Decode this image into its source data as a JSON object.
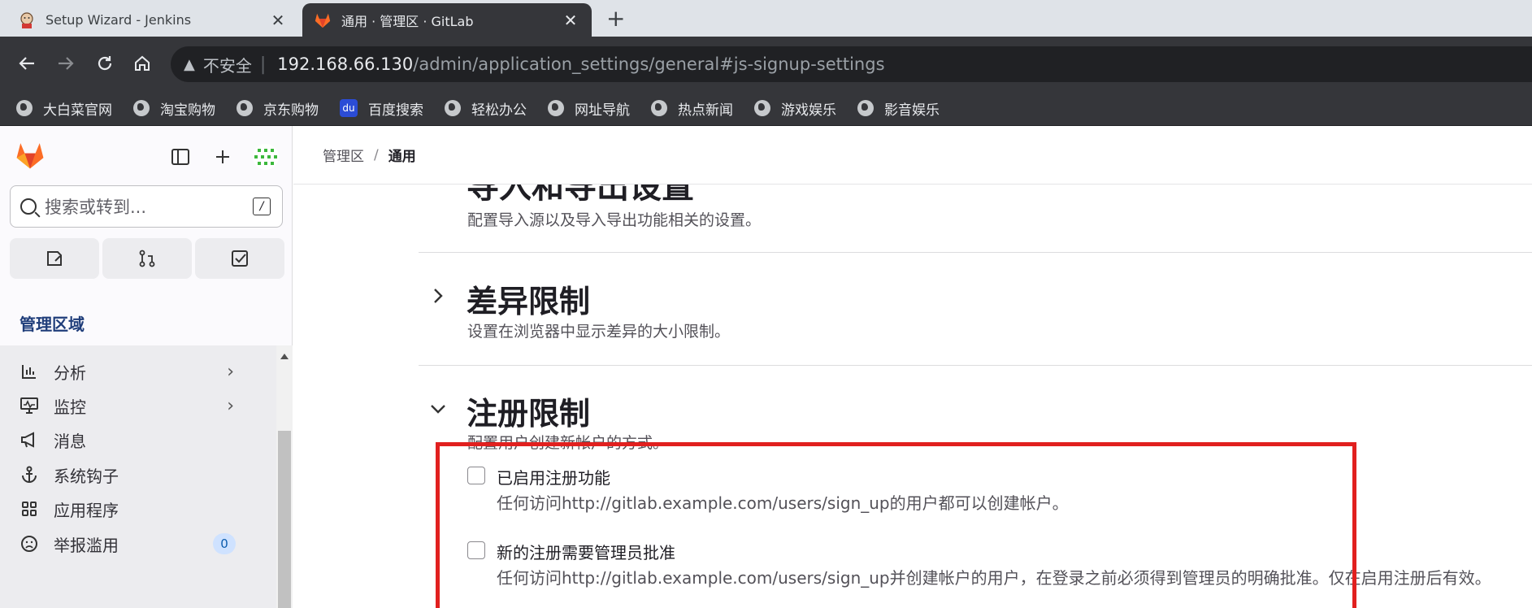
{
  "browser": {
    "tabs": [
      {
        "title": "Setup Wizard - Jenkins",
        "icon": "jenkins-icon",
        "active": false
      },
      {
        "title": "通用 · 管理区 · GitLab",
        "icon": "gitlab-icon",
        "active": true
      }
    ],
    "close_glyph": "✕",
    "new_tab_glyph": "+",
    "security_label": "不安全",
    "url_host": "192.168.66.130",
    "url_path": "/admin/application_settings/general#js-signup-settings",
    "bookmarks": [
      {
        "label": "大白菜官网",
        "icon": "globe-icon"
      },
      {
        "label": "淘宝购物",
        "icon": "globe-icon"
      },
      {
        "label": "京东购物",
        "icon": "globe-icon"
      },
      {
        "label": "百度搜索",
        "icon": "baidu-paw-icon"
      },
      {
        "label": "轻松办公",
        "icon": "globe-icon"
      },
      {
        "label": "网址导航",
        "icon": "globe-icon"
      },
      {
        "label": "热点新闻",
        "icon": "globe-icon"
      },
      {
        "label": "游戏娱乐",
        "icon": "globe-icon"
      },
      {
        "label": "影音娱乐",
        "icon": "globe-icon"
      }
    ]
  },
  "sidebar": {
    "search_placeholder": "搜索或转到...",
    "search_shortcut": "/",
    "section_title": "管理区域",
    "items": [
      {
        "label": "分析",
        "icon": "chart-icon",
        "has_chevron": true
      },
      {
        "label": "监控",
        "icon": "monitor-icon",
        "has_chevron": true
      },
      {
        "label": "消息",
        "icon": "megaphone-icon",
        "has_chevron": false
      },
      {
        "label": "系统钩子",
        "icon": "anchor-icon",
        "has_chevron": false
      },
      {
        "label": "应用程序",
        "icon": "grid-icon",
        "has_chevron": false
      },
      {
        "label": "举报滥用",
        "icon": "sad-face-icon",
        "has_chevron": false,
        "badge": "0"
      }
    ]
  },
  "breadcrumb": {
    "parent": "管理区",
    "separator": "/",
    "current": "通用"
  },
  "settings": {
    "cut_heading": "导入和导出设置",
    "import_desc": "配置导入源以及导入导出功能相关的设置。",
    "sections": [
      {
        "title": "差异限制",
        "desc": "设置在浏览器中显示差异的大小限制。",
        "expanded": false
      },
      {
        "title": "注册限制",
        "desc": "配置用户创建新帐户的方式。",
        "expanded": true
      }
    ],
    "checkboxes": [
      {
        "label": "已启用注册功能",
        "help": "任何访问http://gitlab.example.com/users/sign_up的用户都可以创建帐户。",
        "checked": false
      },
      {
        "label": "新的注册需要管理员批准",
        "help": "任何访问http://gitlab.example.com/users/sign_up并创建帐户的用户，在登录之前必须得到管理员的明确批准。仅在启用注册后有效。",
        "checked": false
      }
    ]
  },
  "colors": {
    "highlight_border": "#e1201f",
    "gitlab_orange": "#fc6d26",
    "chrome_dark": "#35363a"
  }
}
